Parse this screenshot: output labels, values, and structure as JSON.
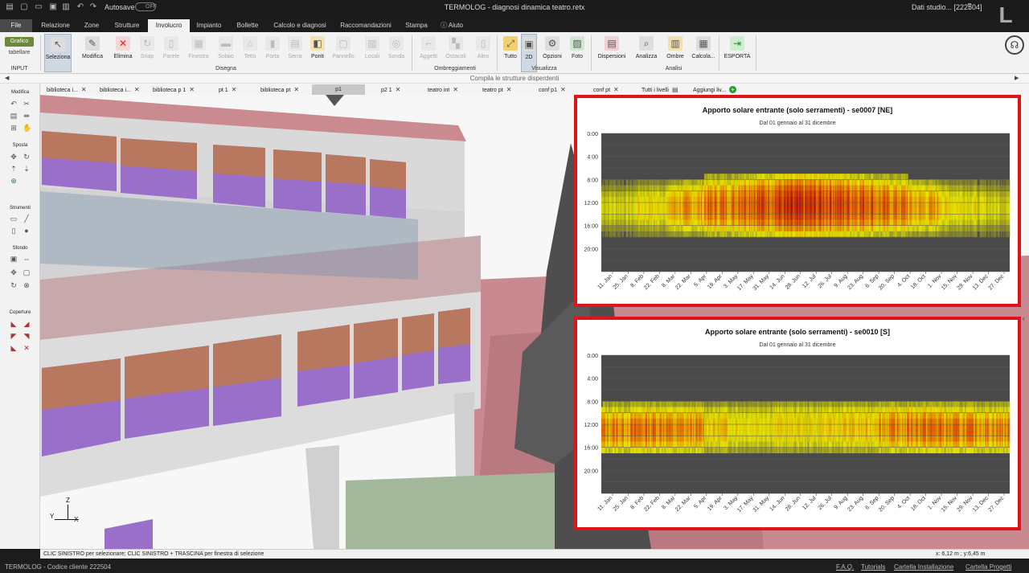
{
  "titlebar": {
    "autosave": "Autosave",
    "toggle": "OFF",
    "title": "TERMOLOG - diagnosi dinamica teatro.retx",
    "user": "Dati studio... [222504]"
  },
  "menu": [
    "File",
    "Relazione",
    "Zone",
    "Strutture",
    "Involucro",
    "Impianto",
    "Bollette",
    "Calcolo e diagnosi",
    "Raccomandazioni",
    "Stampa",
    "Aiuto"
  ],
  "menu_active": "Involucro",
  "input": {
    "grafico": "Grafico",
    "tabellare": "tabellare",
    "label": "INPUT"
  },
  "ribbon": {
    "buttons": [
      "Seleziona",
      "Modifica",
      "Elimina",
      "Snap",
      "Parete",
      "Finestra",
      "Solaio",
      "Tetto",
      "Porta",
      "Serra",
      "Ponti",
      "Pannello",
      "Locali",
      "Sonda",
      "Aggetti",
      "Ostacoli",
      "Altro",
      "Tutto",
      "2D",
      "Opzioni",
      "Foto",
      "Dispersioni",
      "Analizza",
      "Ombre",
      "Calcola...",
      "ESPORTA"
    ],
    "groups": [
      "Disegna",
      "Ombreggiamenti",
      "Visualizza",
      "Analisi"
    ]
  },
  "subbar": "Compila le strutture disperdenti",
  "left_sections": [
    "Modifica",
    "Sposta",
    "Strumenti",
    "Sfondo",
    "Coperture"
  ],
  "level_tabs": [
    "biblioteca i...",
    "biblioteca i...",
    "biblioteca p 1",
    "pt 1",
    "biblioteca pt",
    "p1",
    "p2 1",
    "teatro int",
    "teatro pt",
    "conf p1",
    "conf pt",
    "Tutti i livelli",
    "Aggiungi liv..."
  ],
  "active_tab": "p1",
  "status": {
    "hint": "CLIC SINISTRO per selezionare; CLIC SINISTRO + TRASCINA per finestra di selezione",
    "coords": "x: 6,12 m ; y:6,45 m"
  },
  "footer": {
    "left": "TERMOLOG - Codice cliente 222504",
    "links": [
      "F.A.Q.",
      "Tutorials",
      "Cartella Installazione",
      "Cartella Progetti"
    ]
  },
  "colors": {
    "accent_red": "#e0121a",
    "ribbon_bg": "#f2f2f2",
    "dark_bg": "#1c1c1c"
  },
  "chart_data": [
    {
      "type": "heatmap",
      "title": "Apporto solare entrante (solo serramenti) - se0007 [NE]",
      "subtitle": "Dal 01 gennaio al 31 dicembre",
      "y_ticks": [
        "0:00",
        "4:00",
        "8:00",
        "12:00",
        "16:00",
        "20:00"
      ],
      "x_ticks": [
        "11. Jan",
        "25. Jan",
        "8. Feb",
        "22. Feb",
        "8. Mar",
        "22. Mar",
        "5. Apr",
        "19. Apr",
        "3. May",
        "17. May",
        "31. May",
        "14. Jun",
        "28. Jun",
        "12. Jul",
        "26. Jul",
        "9. Aug",
        "23. Aug",
        "6. Sep",
        "20. Sep",
        "4. Oct",
        "18. Oct",
        "1. Nov",
        "15. Nov",
        "29. Nov",
        "13. Dec",
        "27. Dec"
      ],
      "x_range_days": [
        1,
        365
      ],
      "y_range_hours": [
        0,
        24
      ],
      "intensity_by_month": [
        0.35,
        0.45,
        0.6,
        0.75,
        0.9,
        0.95,
        0.95,
        0.9,
        0.75,
        0.6,
        0.45,
        0.35
      ],
      "active_hours_winter": [
        9,
        16
      ],
      "active_hours_summer": [
        7,
        17
      ],
      "colorscale": [
        "#4a4a4a",
        "#e6e600",
        "#e06000",
        "#b01010"
      ]
    },
    {
      "type": "heatmap",
      "title": "Apporto solare entrante (solo serramenti) - se0010 [S]",
      "subtitle": "Dal 01 gennaio al 31 dicembre",
      "y_ticks": [
        "0:00",
        "4:00",
        "8:00",
        "12:00",
        "16:00",
        "20:00"
      ],
      "x_ticks": [
        "11. Jan",
        "25. Jan",
        "8. Feb",
        "22. Feb",
        "8. Mar",
        "22. Mar",
        "5. Apr",
        "19. Apr",
        "3. May",
        "17. May",
        "31. May",
        "14. Jun",
        "28. Jun",
        "12. Jul",
        "26. Jul",
        "9. Aug",
        "23. Aug",
        "6. Sep",
        "20. Sep",
        "4. Oct",
        "18. Oct",
        "1. Nov",
        "15. Nov",
        "29. Nov",
        "13. Dec",
        "27. Dec"
      ],
      "x_range_days": [
        1,
        365
      ],
      "y_range_hours": [
        0,
        24
      ],
      "intensity_by_month": [
        0.7,
        0.75,
        0.65,
        0.5,
        0.45,
        0.45,
        0.45,
        0.5,
        0.65,
        0.75,
        0.7,
        0.7
      ],
      "active_hours_winter": [
        9,
        16
      ],
      "active_hours_summer": [
        8,
        16
      ],
      "colorscale": [
        "#4a4a4a",
        "#e6e600",
        "#e06000",
        "#b01010"
      ]
    }
  ]
}
